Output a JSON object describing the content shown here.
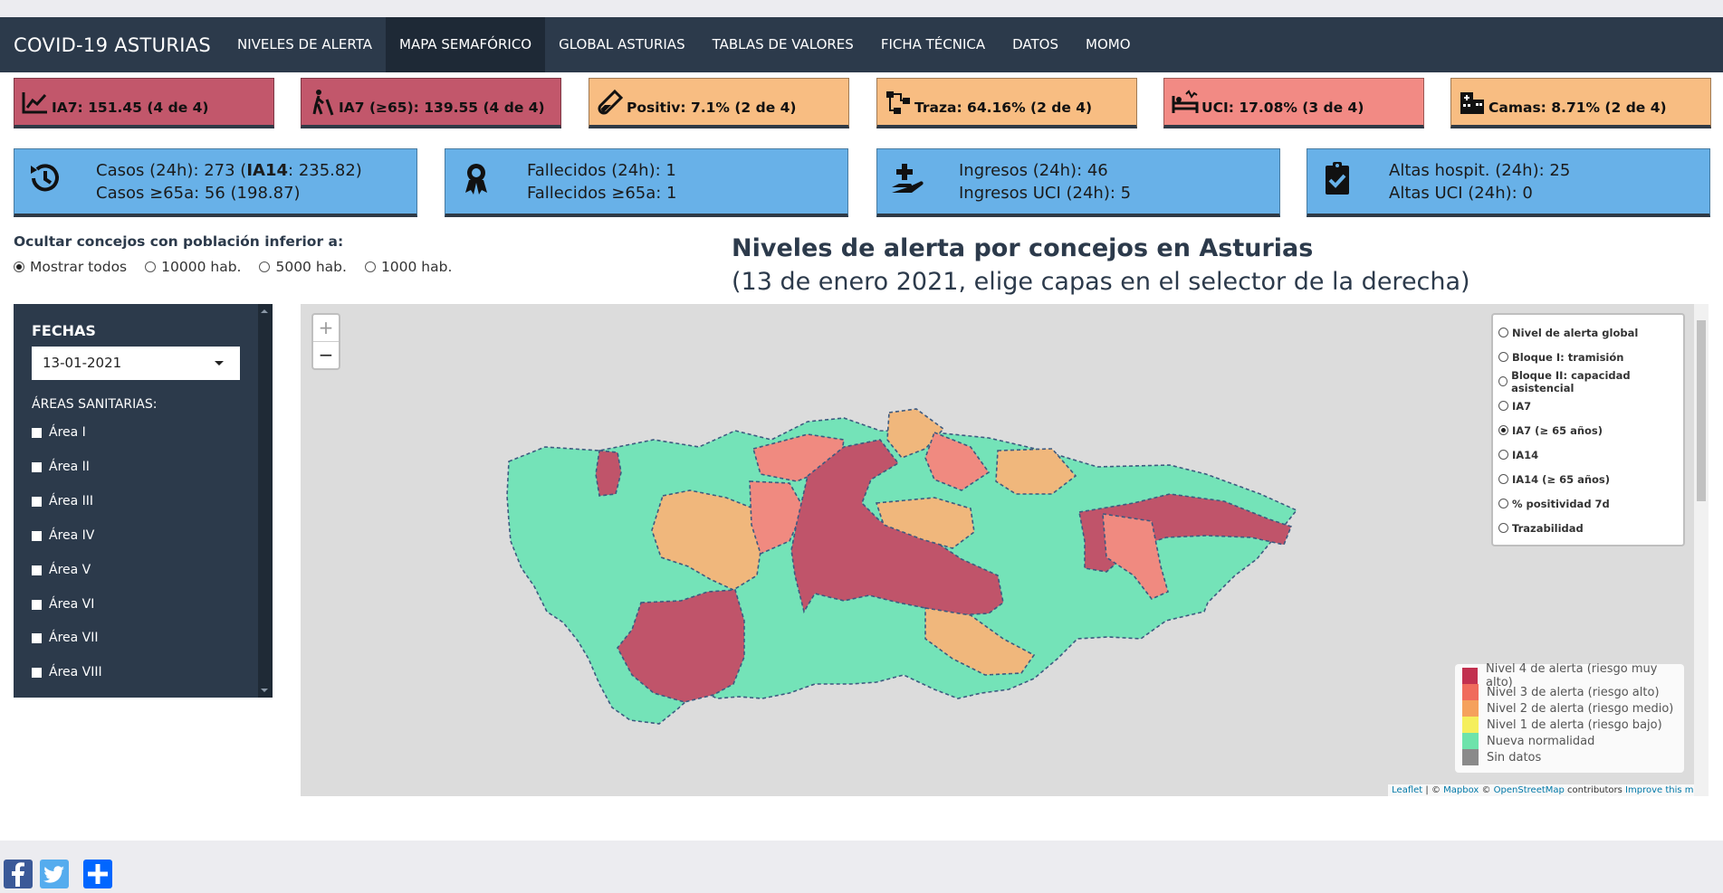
{
  "nav": {
    "brand": "COVID-19 ASTURIAS",
    "items": [
      {
        "label": "NIVELES DE ALERTA",
        "active": false
      },
      {
        "label": "MAPA SEMAFÓRICO",
        "active": true
      },
      {
        "label": "GLOBAL ASTURIAS",
        "active": false
      },
      {
        "label": "TABLAS DE VALORES",
        "active": false
      },
      {
        "label": "FICHA TÉCNICA",
        "active": false
      },
      {
        "label": "DATOS",
        "active": false
      },
      {
        "label": "MOMO",
        "active": false
      }
    ]
  },
  "kpis": [
    {
      "label": "IA7: 151.45 (4 de 4)",
      "color": "#c2576b",
      "icon": "trend-chart-icon"
    },
    {
      "label": "IA7 (≥65): 139.55 (4 de 4)",
      "color": "#c2576b",
      "icon": "elderly-person-icon"
    },
    {
      "label": "Positiv: 7.1% (2 de 4)",
      "color": "#f8bd82",
      "icon": "test-tube-icon"
    },
    {
      "label": "Traza: 64.16% (2 de 4)",
      "color": "#f8bd82",
      "icon": "network-trace-icon"
    },
    {
      "label": "UCI: 17.08% (3 de 4)",
      "color": "#f28a84",
      "icon": "icu-bed-icon"
    },
    {
      "label": "Camas: 8.71% (2 de 4)",
      "color": "#f8bd82",
      "icon": "hospital-building-icon"
    }
  ],
  "stats": [
    {
      "line1_a": "Casos (24h): 273 (",
      "line1_b": "IA14",
      "line1_c": ": 235.82)",
      "line2": "Casos ≥65a: 56 (198.87)",
      "icon": "history-icon"
    },
    {
      "line1": "Fallecidos (24h): 1",
      "line2": "Fallecidos ≥65a: 1",
      "icon": "ribbon-icon"
    },
    {
      "line1": "Ingresos (24h): 46",
      "line2": "Ingresos UCI (24h): 5",
      "icon": "hand-plus-icon"
    },
    {
      "line1": "Altas hospit. (24h): 25",
      "line2": "Altas UCI (24h): 0",
      "icon": "clipboard-check-icon"
    }
  ],
  "filter": {
    "title": "Ocultar concejos con población inferior a:",
    "options": [
      {
        "label": "Mostrar todos",
        "selected": true
      },
      {
        "label": "10000 hab.",
        "selected": false
      },
      {
        "label": "5000 hab.",
        "selected": false
      },
      {
        "label": "1000 hab.",
        "selected": false
      }
    ]
  },
  "map_header": {
    "title": "Niveles de alerta por concejos en Asturias",
    "subtitle": "(13 de enero 2021, elige capas en el selector de la derecha)"
  },
  "sidebar": {
    "fechas_label": "FECHAS",
    "date_value": "13-01-2021",
    "areas_label": "ÁREAS SANITARIAS:",
    "areas": [
      "Área I",
      "Área II",
      "Área III",
      "Área IV",
      "Área V",
      "Área VI",
      "Área VII",
      "Área VIII"
    ]
  },
  "map": {
    "zoom_in": "+",
    "zoom_out": "−",
    "layers": [
      {
        "label": "Nivel de alerta global",
        "selected": false
      },
      {
        "label": "Bloque I: tramisión",
        "selected": false
      },
      {
        "label": "Bloque II: capacidad asistencial",
        "selected": false
      },
      {
        "label": "IA7",
        "selected": false
      },
      {
        "label": "IA7 (≥ 65 años)",
        "selected": true
      },
      {
        "label": "IA14",
        "selected": false
      },
      {
        "label": "IA14 (≥ 65 años)",
        "selected": false
      },
      {
        "label": "% positividad 7d",
        "selected": false
      },
      {
        "label": "Trazabilidad",
        "selected": false
      }
    ],
    "legend": [
      {
        "label": "Nivel 4 de alerta (riesgo muy alto)",
        "color": "#c2304f"
      },
      {
        "label": "Nivel 3 de alerta (riesgo alto)",
        "color": "#f06b5c"
      },
      {
        "label": "Nivel 2 de alerta (riesgo medio)",
        "color": "#f5a15c"
      },
      {
        "label": "Nivel 1 de alerta (riesgo bajo)",
        "color": "#f5ef5c"
      },
      {
        "label": "Nueva normalidad",
        "color": "#6ee3ab"
      },
      {
        "label": "Sin datos",
        "color": "#8a8a8a"
      }
    ],
    "attribution": {
      "leaflet": "Leaflet",
      "sep1": " | © ",
      "mapbox": "Mapbox",
      "sep2": " © ",
      "osm": "OpenStreetMap",
      "contrib": " contributors ",
      "improve": "Improve this map"
    }
  },
  "share": [
    {
      "icon": "facebook-icon",
      "color": "#3b5998"
    },
    {
      "icon": "twitter-icon",
      "color": "#55acee"
    },
    {
      "icon": "share-plus-icon",
      "color": "#0166ff"
    }
  ]
}
